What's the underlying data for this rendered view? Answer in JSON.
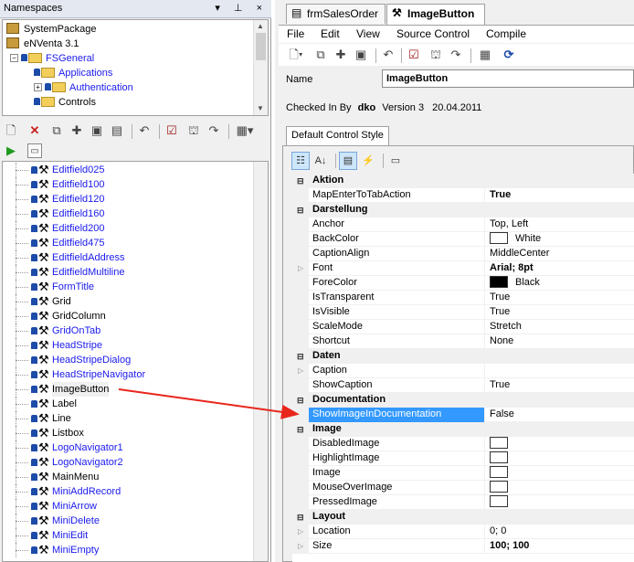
{
  "namespaces": {
    "title": "Namespaces",
    "header_buttons": "▾ ⊥ ×",
    "tree": [
      {
        "label": "SystemPackage",
        "kind": "package"
      },
      {
        "label": "eNVenta 3.1",
        "kind": "package"
      },
      {
        "label": "FSGeneral",
        "kind": "folder",
        "expander": "−"
      },
      {
        "label": "Applications",
        "kind": "folder"
      },
      {
        "label": "Authentication",
        "kind": "folder",
        "expander": "+"
      },
      {
        "label": "Controls",
        "kind": "folder"
      }
    ]
  },
  "controls": [
    {
      "label": "Editfield025",
      "blue": true
    },
    {
      "label": "Editfield100",
      "blue": true
    },
    {
      "label": "Editfield120",
      "blue": true
    },
    {
      "label": "Editfield160",
      "blue": true
    },
    {
      "label": "Editfield200",
      "blue": true
    },
    {
      "label": "Editfield475",
      "blue": true
    },
    {
      "label": "EditfieldAddress",
      "blue": true
    },
    {
      "label": "EditfieldMultiline",
      "blue": true
    },
    {
      "label": "FormTitle",
      "blue": true
    },
    {
      "label": "Grid",
      "blue": false
    },
    {
      "label": "GridColumn",
      "blue": false
    },
    {
      "label": "GridOnTab",
      "blue": true
    },
    {
      "label": "HeadStripe",
      "blue": true
    },
    {
      "label": "HeadStripeDialog",
      "blue": true
    },
    {
      "label": "HeadStripeNavigator",
      "blue": true
    },
    {
      "label": "ImageButton",
      "blue": false,
      "selected": true
    },
    {
      "label": "Label",
      "blue": false
    },
    {
      "label": "Line",
      "blue": false
    },
    {
      "label": "Listbox",
      "blue": false
    },
    {
      "label": "LogoNavigator1",
      "blue": true
    },
    {
      "label": "LogoNavigator2",
      "blue": true
    },
    {
      "label": "MainMenu",
      "blue": false
    },
    {
      "label": "MiniAddRecord",
      "blue": true
    },
    {
      "label": "MiniArrow",
      "blue": true
    },
    {
      "label": "MiniDelete",
      "blue": true
    },
    {
      "label": "MiniEdit",
      "blue": true
    },
    {
      "label": "MiniEmpty",
      "blue": true
    }
  ],
  "tabs": [
    {
      "label": "frmSalesOrder",
      "active": false
    },
    {
      "label": "ImageButton",
      "active": true
    }
  ],
  "menu": [
    "File",
    "Edit",
    "View",
    "Source Control",
    "Compile"
  ],
  "name_label": "Name",
  "name_value": "ImageButton",
  "checked_in": {
    "label": "Checked In By",
    "user": "dko",
    "version": "Version 3",
    "date": "20.04.2011"
  },
  "prop_tab": "Default Control Style",
  "properties": [
    {
      "cat": "Aktion"
    },
    {
      "name": "MapEnterToTabAction",
      "value": "True",
      "bold": true
    },
    {
      "cat": "Darstellung"
    },
    {
      "name": "Anchor",
      "value": "Top, Left"
    },
    {
      "name": "BackColor",
      "value": "White",
      "swatch": "#ffffff"
    },
    {
      "name": "CaptionAlign",
      "value": "MiddleCenter"
    },
    {
      "name": "Font",
      "value": "Arial; 8pt",
      "bold": true,
      "expand": true
    },
    {
      "name": "ForeColor",
      "value": "Black",
      "swatch": "#000000"
    },
    {
      "name": "IsTransparent",
      "value": "True"
    },
    {
      "name": "IsVisible",
      "value": "True"
    },
    {
      "name": "ScaleMode",
      "value": "Stretch"
    },
    {
      "name": "Shortcut",
      "value": "None"
    },
    {
      "cat": "Daten"
    },
    {
      "name": "Caption",
      "value": "",
      "expand": true
    },
    {
      "name": "ShowCaption",
      "value": "True"
    },
    {
      "cat": "Documentation"
    },
    {
      "name": "ShowImageInDocumentation",
      "value": "False",
      "selected": true
    },
    {
      "cat": "Image"
    },
    {
      "name": "DisabledImage",
      "value": "",
      "swatch": "#ffffff"
    },
    {
      "name": "HighlightImage",
      "value": "",
      "swatch": "#ffffff"
    },
    {
      "name": "Image",
      "value": "",
      "swatch": "#ffffff"
    },
    {
      "name": "MouseOverImage",
      "value": "",
      "swatch": "#ffffff"
    },
    {
      "name": "PressedImage",
      "value": "",
      "swatch": "#ffffff"
    },
    {
      "cat": "Layout"
    },
    {
      "name": "Location",
      "value": "0; 0",
      "expand": true
    },
    {
      "name": "Size",
      "value": "100; 100",
      "bold": true,
      "expand": true
    }
  ],
  "colors": {
    "selection": "#3399ff",
    "link": "#1a1aee",
    "arrow": "#e8261c"
  }
}
